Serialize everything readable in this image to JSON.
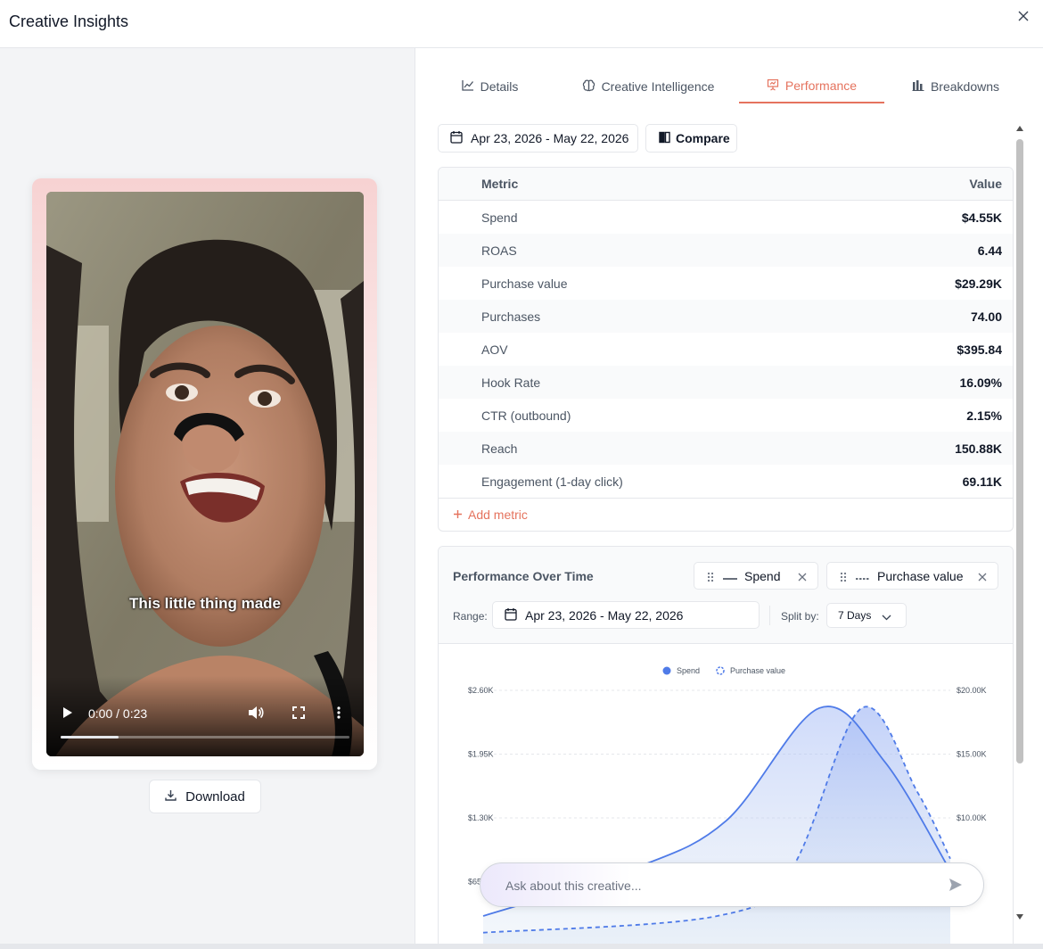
{
  "window": {
    "title": "Creative Insights"
  },
  "video": {
    "caption": "This little thing made",
    "time": "0:00 / 0:23",
    "progress_fraction": 0.2
  },
  "download_label": "Download",
  "tabs": [
    {
      "label": "Details",
      "icon": "line-chart-icon"
    },
    {
      "label": "Creative Intelligence",
      "icon": "brain-icon"
    },
    {
      "label": "Performance",
      "icon": "presentation-icon",
      "active": true
    },
    {
      "label": "Breakdowns",
      "icon": "bar-chart-icon"
    }
  ],
  "date_range": "Apr 23, 2026 - May 22, 2026",
  "compare_label": "Compare",
  "metrics": {
    "header": {
      "metric": "Metric",
      "value": "Value"
    },
    "rows": [
      {
        "name": "Spend",
        "value": "$4.55K"
      },
      {
        "name": "ROAS",
        "value": "6.44"
      },
      {
        "name": "Purchase value",
        "value": "$29.29K"
      },
      {
        "name": "Purchases",
        "value": "74.00"
      },
      {
        "name": "AOV",
        "value": "$395.84"
      },
      {
        "name": "Hook Rate",
        "value": "16.09%"
      },
      {
        "name": "CTR (outbound)",
        "value": "2.15%"
      },
      {
        "name": "Reach",
        "value": "150.88K"
      },
      {
        "name": "Engagement (1-day click)",
        "value": "69.11K"
      }
    ],
    "add_label": "Add metric"
  },
  "performance": {
    "title": "Performance Over Time",
    "chips": [
      {
        "label": "Spend",
        "line": "solid"
      },
      {
        "label": "Purchase value",
        "line": "dashed"
      }
    ],
    "range_label": "Range:",
    "range_value": "Apr 23, 2026 - May 22, 2026",
    "split_label": "Split by:",
    "split_value": "7 Days"
  },
  "chart_data": {
    "type": "area",
    "series": [
      {
        "name": "Spend",
        "axis": "left",
        "style": "solid",
        "color": "#4f7be8"
      },
      {
        "name": "Purchase value",
        "axis": "right",
        "style": "dashed",
        "color": "#4f7be8"
      }
    ],
    "y_left_ticks": [
      "$2.60K",
      "$1.95K",
      "$1.30K",
      "$650"
    ],
    "y_right_ticks": [
      "$20.00K",
      "$15.00K",
      "$10.00K"
    ],
    "ylim_left": [
      0,
      2600
    ],
    "ylim_right": [
      0,
      20000
    ],
    "spend_points": [
      [
        0.0,
        300
      ],
      [
        0.32,
        780
      ],
      [
        0.52,
        1270
      ],
      [
        0.72,
        2420
      ],
      [
        0.86,
        1870
      ],
      [
        1.0,
        760
      ]
    ],
    "purchase_points": [
      [
        0.0,
        1000
      ],
      [
        0.5,
        2300
      ],
      [
        0.66,
        6000
      ],
      [
        0.81,
        18600
      ],
      [
        0.93,
        12000
      ],
      [
        1.0,
        6800
      ]
    ],
    "legend_position": "top",
    "grid": true
  },
  "ask": {
    "placeholder": "Ask about this creative..."
  },
  "colors": {
    "accent": "#e5735e",
    "series": "#4f7be8"
  }
}
